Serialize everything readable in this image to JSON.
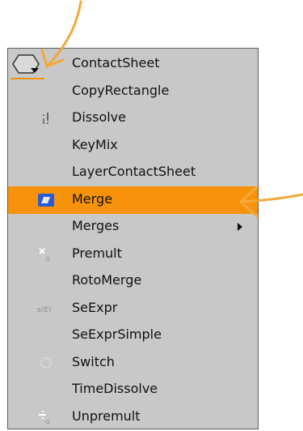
{
  "menu": {
    "items": [
      {
        "label": "ContactSheet",
        "icon": "none",
        "submenu": false,
        "selected": false
      },
      {
        "label": "CopyRectangle",
        "icon": "none",
        "submenu": false,
        "selected": false
      },
      {
        "label": "Dissolve",
        "icon": "dissolve-icon",
        "submenu": false,
        "selected": false
      },
      {
        "label": "KeyMix",
        "icon": "none",
        "submenu": false,
        "selected": false
      },
      {
        "label": "LayerContactSheet",
        "icon": "none",
        "submenu": false,
        "selected": false
      },
      {
        "label": "Merge",
        "icon": "merge-icon",
        "submenu": false,
        "selected": true
      },
      {
        "label": "Merges",
        "icon": "none",
        "submenu": true,
        "selected": false
      },
      {
        "label": "Premult",
        "icon": "premult-icon",
        "submenu": false,
        "selected": false
      },
      {
        "label": "RotoMerge",
        "icon": "none",
        "submenu": false,
        "selected": false
      },
      {
        "label": "SeExpr",
        "icon": "seexpr-icon",
        "icon_text": "s(E)",
        "submenu": false,
        "selected": false
      },
      {
        "label": "SeExprSimple",
        "icon": "none",
        "submenu": false,
        "selected": false
      },
      {
        "label": "Switch",
        "icon": "switch-icon",
        "submenu": false,
        "selected": false
      },
      {
        "label": "TimeDissolve",
        "icon": "none",
        "submenu": false,
        "selected": false
      },
      {
        "label": "Unpremult",
        "icon": "unpremult-icon",
        "submenu": false,
        "selected": false
      }
    ]
  },
  "group_icon": "merge-group-icon",
  "colors": {
    "menu_bg": "#c8c8c8",
    "highlight": "#f7930b",
    "annotation": "#f2a93b",
    "text": "#111111"
  }
}
